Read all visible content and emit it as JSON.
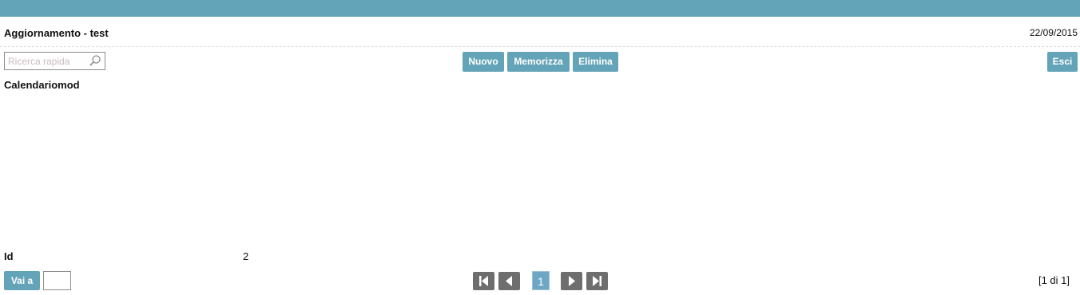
{
  "header": {
    "title": "Aggiornamento - test",
    "date": "22/09/2015"
  },
  "search": {
    "placeholder": "Ricerca rapida",
    "value": "",
    "icon": "search-icon"
  },
  "toolbar": {
    "new_label": "Nuovo",
    "save_label": "Memorizza",
    "delete_label": "Elimina",
    "exit_label": "Esci"
  },
  "section": {
    "title": "Calendariomod"
  },
  "record": {
    "field_label": "Id",
    "field_value": "2"
  },
  "footer": {
    "goto_label": "Vai a",
    "goto_value": "",
    "current_page": "1",
    "record_count": "[1 di 1]",
    "icons": [
      "first-page-icon",
      "previous-page-icon",
      "next-page-icon",
      "last-page-icon"
    ]
  },
  "colors": {
    "accent": "#64a4b8",
    "pager_button": "#6e6e6e",
    "current_page": "#6ea7c5"
  }
}
